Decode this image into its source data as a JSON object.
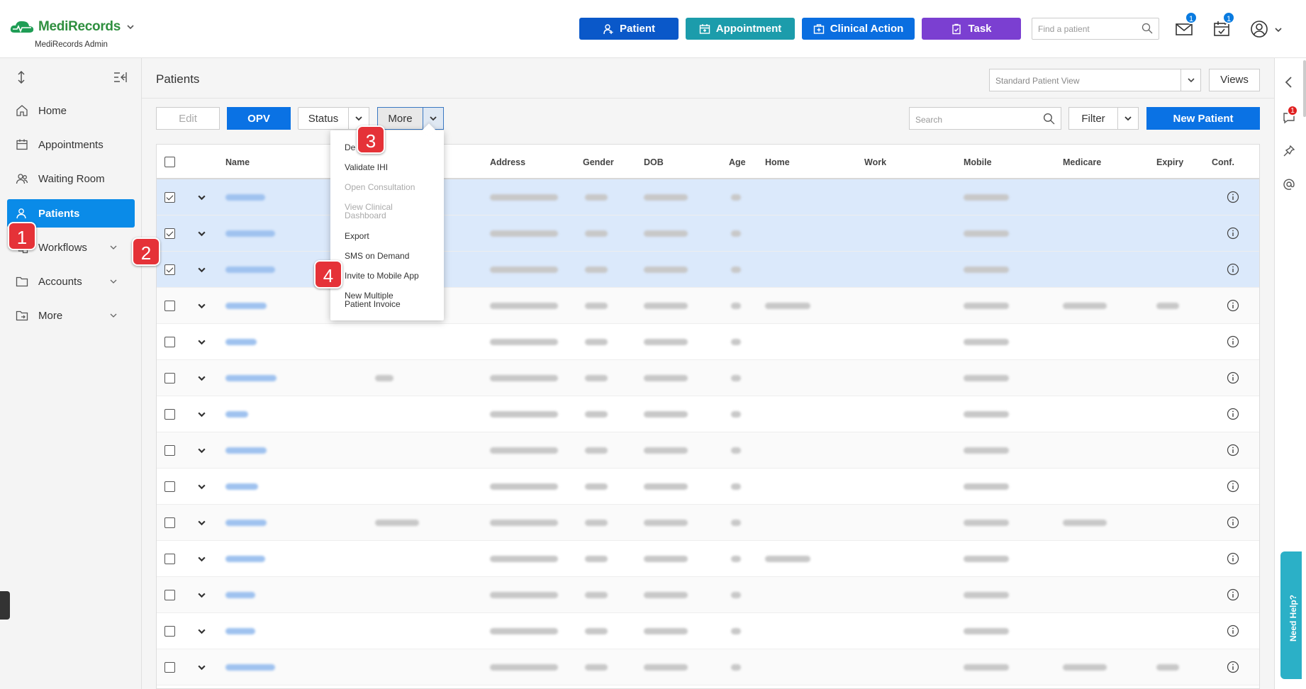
{
  "header": {
    "brand_name": "MediRecords",
    "brand_sub": "MediRecords Admin",
    "buttons": [
      {
        "label": "Patient",
        "color": "#0a58c9"
      },
      {
        "label": "Appointment",
        "color": "#1c9cab"
      },
      {
        "label": "Clinical Action",
        "color": "#0a6ee0"
      },
      {
        "label": "Task",
        "color": "#7b3fd1"
      }
    ],
    "find_placeholder": "Find a patient",
    "mail_badge": "1",
    "tasks_badge": "1"
  },
  "sidebar": {
    "items": [
      {
        "label": "Home",
        "icon": "home-icon"
      },
      {
        "label": "Appointments",
        "icon": "calendar-icon"
      },
      {
        "label": "Waiting Room",
        "icon": "people-icon"
      },
      {
        "label": "Patients",
        "icon": "patient-icon",
        "active": true
      },
      {
        "label": "Workflows",
        "icon": "workflow-icon"
      },
      {
        "label": "Accounts",
        "icon": "folder-icon"
      },
      {
        "label": "More",
        "icon": "folder-arrow-icon"
      }
    ]
  },
  "page": {
    "title": "Patients",
    "view_select": "Standard Patient View",
    "views_label": "Views"
  },
  "toolbar": {
    "edit": "Edit",
    "opv": "OPV",
    "status": "Status",
    "more": "More",
    "search_placeholder": "Search",
    "filter": "Filter",
    "new_patient": "New Patient"
  },
  "table": {
    "columns": [
      "Name",
      "Address",
      "Gender",
      "DOB",
      "Age",
      "Home",
      "Work",
      "Mobile",
      "Medicare",
      "Expiry",
      "Conf."
    ]
  },
  "more_menu": {
    "items": [
      {
        "label": "De",
        "disabled": false
      },
      {
        "label": "Validate IHI",
        "disabled": false
      },
      {
        "label": "Open Consultation",
        "disabled": true
      },
      {
        "label": "View Clinical\nDashboard",
        "disabled": true
      },
      {
        "label": "Export",
        "disabled": false
      },
      {
        "label": "SMS on Demand",
        "disabled": false
      },
      {
        "label": "Invite to Mobile App",
        "disabled": false
      },
      {
        "label": "New Multiple\nPatient Invoice",
        "disabled": false
      }
    ]
  },
  "callouts": [
    "1",
    "2",
    "3",
    "4"
  ],
  "right_rail": {
    "notification_badge": "1",
    "help_label": "Need Help?"
  }
}
